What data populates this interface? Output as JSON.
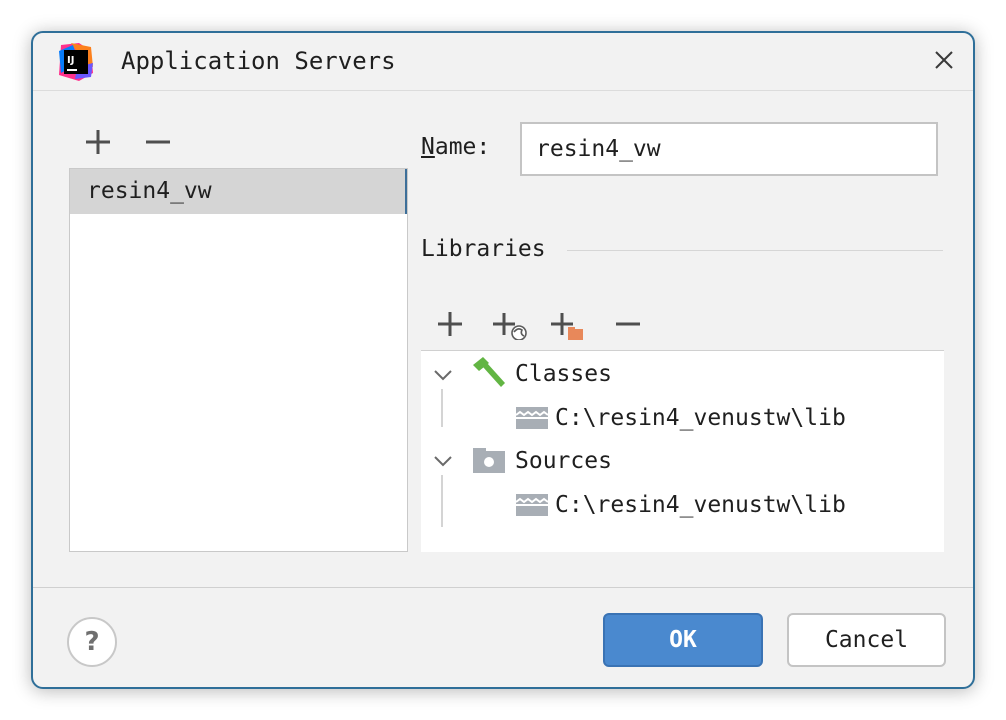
{
  "dialog": {
    "title": "Application Servers",
    "app_icon": "intellij-idea-logo",
    "app_icon_text": "IJ",
    "close_icon": "close-icon"
  },
  "servers": {
    "toolbar": {
      "add_icon": "plus-icon",
      "remove_icon": "minus-icon"
    },
    "items": [
      {
        "label": "resin4_vw",
        "selected": true
      }
    ]
  },
  "form": {
    "name_label_mnemonic": "N",
    "name_label_rest": "ame:",
    "name_value": "resin4_vw"
  },
  "libraries": {
    "title": "Libraries",
    "toolbar": {
      "add_icon": "plus-icon",
      "add_external_icon": "plus-globe-icon",
      "add_folder_icon": "plus-folder-icon",
      "remove_icon": "minus-icon"
    },
    "tree": [
      {
        "label": "Classes",
        "icon": "hammer-icon",
        "expanded": true,
        "children": [
          {
            "label": "C:\\resin4_venustw\\lib",
            "icon": "jar-archive-icon"
          }
        ]
      },
      {
        "label": "Sources",
        "icon": "source-folder-icon",
        "expanded": true,
        "children": [
          {
            "label": "C:\\resin4_venustw\\lib",
            "icon": "jar-archive-icon"
          }
        ]
      }
    ]
  },
  "footer": {
    "help_label": "?",
    "ok_label": "OK",
    "cancel_label": "Cancel"
  },
  "colors": {
    "accent": "#4a89cf",
    "selection": "#d5d5d5",
    "dialog_bg": "#f2f2f2",
    "border": "#2f6f99"
  }
}
